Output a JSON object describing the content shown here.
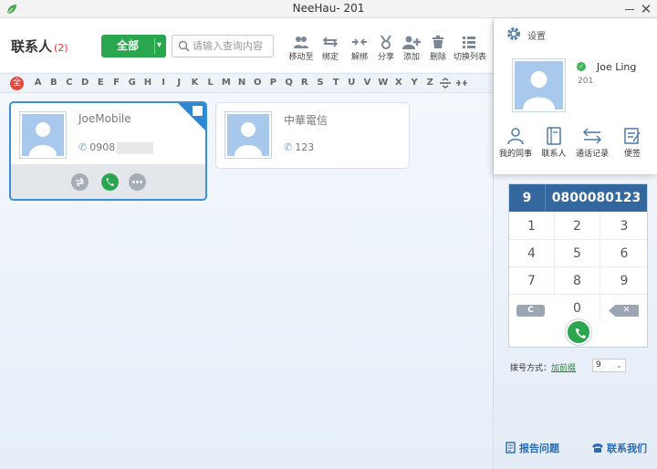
{
  "window": {
    "title": "NeeHau- 201",
    "close_glyph": "✕"
  },
  "header": {
    "title": "联系人",
    "count": "(2)",
    "filter_label": "全部",
    "search_placeholder": "请输入查询内容"
  },
  "toolbar": [
    {
      "label": "移动至",
      "icon": "move-icon"
    },
    {
      "label": "绑定",
      "icon": "bind-icon"
    },
    {
      "label": "解绑",
      "icon": "unbind-icon"
    },
    {
      "label": "分享",
      "icon": "share-icon"
    },
    {
      "label": "添加",
      "icon": "add-contact-icon"
    },
    {
      "label": "删除",
      "icon": "trash-icon"
    },
    {
      "label": "切换列表",
      "icon": "list-view-icon"
    }
  ],
  "alphabet": {
    "all_label": "全",
    "letters": [
      "A",
      "B",
      "C",
      "D",
      "E",
      "F",
      "G",
      "H",
      "I",
      "J",
      "K",
      "L",
      "M",
      "N",
      "O",
      "P",
      "Q",
      "R",
      "S",
      "T",
      "U",
      "V",
      "W",
      "X",
      "Y",
      "Z"
    ]
  },
  "contacts": [
    {
      "name": "JoeMobile",
      "phone": "0908",
      "selected": true
    },
    {
      "name": "中華電信",
      "phone": "123",
      "selected": false
    }
  ],
  "profile": {
    "settings_label": "设置",
    "name": "Joe Ling",
    "extension": "201",
    "status_color": "#3fb65a"
  },
  "quick_links": [
    {
      "label": "我的同事",
      "icon": "person-icon"
    },
    {
      "label": "联系人",
      "icon": "book-icon"
    },
    {
      "label": "通话记录",
      "icon": "call-history-icon"
    },
    {
      "label": "便签",
      "icon": "note-icon"
    }
  ],
  "dialpad": {
    "prefix": "9",
    "number": "0800080123",
    "keys": [
      "1",
      "2",
      "3",
      "4",
      "5",
      "6",
      "7",
      "8",
      "9"
    ],
    "zero": "0",
    "clear_label": "C",
    "delete_label": "✕"
  },
  "dial_mode": {
    "label": "拨号方式：",
    "link": "加前缀",
    "prefix_value": "9"
  },
  "footer": {
    "report_label": "报告问题",
    "contact_label": "联系我们"
  },
  "colors": {
    "accent_green": "#2aa64f",
    "accent_blue": "#34679d",
    "badge_red": "#e3463c"
  }
}
